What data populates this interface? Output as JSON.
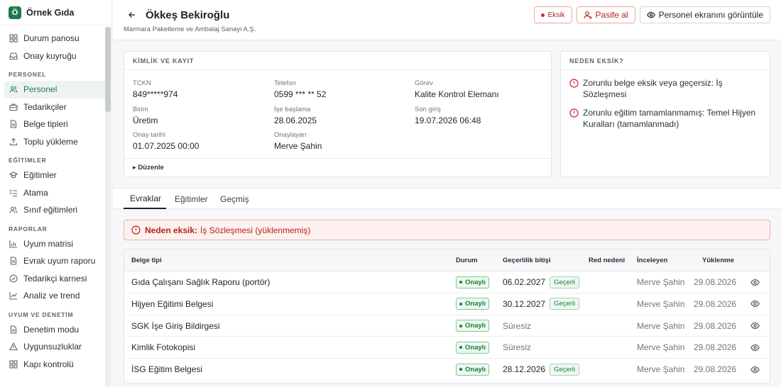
{
  "brand": {
    "logo": "Ö",
    "name": "Örnek Gıda"
  },
  "nav": {
    "top": [
      {
        "label": "Durum panosu",
        "icon": "grid-icon"
      },
      {
        "label": "Onay kuyruğu",
        "icon": "inbox-icon"
      }
    ],
    "sections": [
      {
        "title": "PERSONEL",
        "items": [
          {
            "label": "Personel",
            "icon": "users-icon",
            "active": true
          },
          {
            "label": "Tedarikçiler",
            "icon": "briefcase-icon"
          },
          {
            "label": "Belge tipleri",
            "icon": "document-icon"
          },
          {
            "label": "Toplu yükleme",
            "icon": "upload-icon"
          }
        ]
      },
      {
        "title": "EĞİTİMLER",
        "items": [
          {
            "label": "Eğitimler",
            "icon": "graduation-icon"
          },
          {
            "label": "Atama",
            "icon": "list-check-icon"
          },
          {
            "label": "Sınıf eğitimleri",
            "icon": "users-icon"
          }
        ]
      },
      {
        "title": "RAPORLAR",
        "items": [
          {
            "label": "Uyum matrisi",
            "icon": "bar-chart-icon"
          },
          {
            "label": "Evrak uyum raporu",
            "icon": "document-icon"
          },
          {
            "label": "Tedarikçi karnesi",
            "icon": "check-circle-icon"
          },
          {
            "label": "Analiz ve trend",
            "icon": "trend-icon"
          }
        ]
      },
      {
        "title": "UYUM VE DENETİM",
        "items": [
          {
            "label": "Denetim modu",
            "icon": "document-icon"
          },
          {
            "label": "Uygunsuzluklar",
            "icon": "warning-icon"
          },
          {
            "label": "Kapı kontrolü",
            "icon": "grid-icon"
          }
        ]
      }
    ]
  },
  "header": {
    "title": "Ökkeş Bekiroğlu",
    "subtitle": "Marmara Paketleme ve Ambalaj Sanayi A.Ş.",
    "eksik_label": "Eksik",
    "pasif_label": "Pasife al",
    "view_label": "Personel ekranını görüntüle"
  },
  "kimlik": {
    "heading": "KİMLİK VE KAYIT",
    "fields": {
      "tckn": {
        "label": "TCKN",
        "value": "849*****974"
      },
      "telefon": {
        "label": "Telefon",
        "value": "0599 *** ** 52"
      },
      "gorev": {
        "label": "Görev",
        "value": "Kalite Kontrol Elemanı"
      },
      "birim": {
        "label": "Birim",
        "value": "Üretim"
      },
      "ise_baslama": {
        "label": "İşe başlama",
        "value": "28.06.2025"
      },
      "son_giris": {
        "label": "Son giriş",
        "value": "19.07.2026 06:48"
      },
      "onay_tarihi": {
        "label": "Onay tarihi",
        "value": "01.07.2025 00:00"
      },
      "onaylayan": {
        "label": "Onaylayan",
        "value": "Merve Şahin"
      }
    },
    "duzenle": "▸ Düzenle"
  },
  "neden": {
    "heading": "NEDEN EKSİK?",
    "reasons": [
      "Zorunlu belge eksik veya geçersiz: İş Sözleşmesi",
      "Zorunlu eğitim tamamlanmamış: Temel Hijyen Kuralları (tamamlanmadı)"
    ]
  },
  "tabs": [
    "Evraklar",
    "Eğitimler",
    "Geçmiş"
  ],
  "alert": {
    "prefix": "Neden eksik:",
    "text": "İş Sözleşmesi (yüklenmemiş)"
  },
  "table": {
    "headers": [
      "Belge tipi",
      "Durum",
      "Geçerlilik bitişi",
      "Red nedeni",
      "İnceleyen",
      "Yüklenme"
    ],
    "rows": [
      {
        "type": "Gıda Çalışanı Sağlık Raporu (portör)",
        "status": "Onaylı",
        "expiry": "06.02.2027",
        "valid": "Geçerli",
        "red": "",
        "reviewer": "Merve Şahin",
        "uploaded": "29.08.2026"
      },
      {
        "type": "Hijyen Eğitimi Belgesi",
        "status": "Onaylı",
        "expiry": "30.12.2027",
        "valid": "Geçerli",
        "red": "",
        "reviewer": "Merve Şahin",
        "uploaded": "29.08.2026"
      },
      {
        "type": "SGK İşe Giriş Bildirgesi",
        "status": "Onaylı",
        "expiry": "Süresiz",
        "valid": "",
        "red": "",
        "reviewer": "Merve Şahin",
        "uploaded": "29.08.2026"
      },
      {
        "type": "Kimlik Fotokopisi",
        "status": "Onaylı",
        "expiry": "Süresiz",
        "valid": "",
        "red": "",
        "reviewer": "Merve Şahin",
        "uploaded": "29.08.2026"
      },
      {
        "type": "İSG Eğitim Belgesi",
        "status": "Onaylı",
        "expiry": "28.12.2026",
        "valid": "Geçerli",
        "red": "",
        "reviewer": "Merve Şahin",
        "uploaded": "29.08.2026"
      }
    ]
  }
}
